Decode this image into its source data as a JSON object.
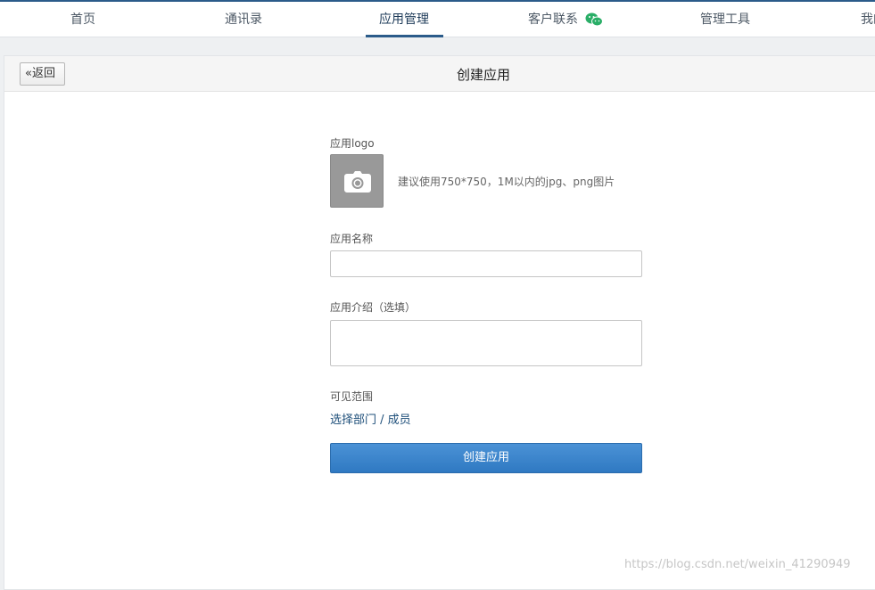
{
  "nav": {
    "items": [
      {
        "label": "首页"
      },
      {
        "label": "通讯录"
      },
      {
        "label": "应用管理"
      },
      {
        "label": "客户联系"
      },
      {
        "label": "管理工具"
      },
      {
        "label": "我的"
      }
    ],
    "active_index": 2
  },
  "header": {
    "back_label": "返回",
    "title": "创建应用"
  },
  "form": {
    "logo_label": "应用logo",
    "logo_hint": "建议使用750*750，1M以内的jpg、png图片",
    "name_label": "应用名称",
    "name_value": "",
    "intro_label": "应用介绍（选填）",
    "intro_value": "",
    "scope_label": "可见范围",
    "scope_link": "选择部门 / 成员",
    "submit_label": "创建应用"
  },
  "watermark": "https://blog.csdn.net/weixin_41290949",
  "colors": {
    "accent": "#2b5b8a",
    "primary_button": "#3a86cc",
    "link": "#1e4f7a",
    "wechat_green": "#2aae67"
  },
  "icons": {
    "logo_upload": "camera-icon",
    "back": "double-chevron-left-icon",
    "customer_contact": "wechat-icon"
  }
}
